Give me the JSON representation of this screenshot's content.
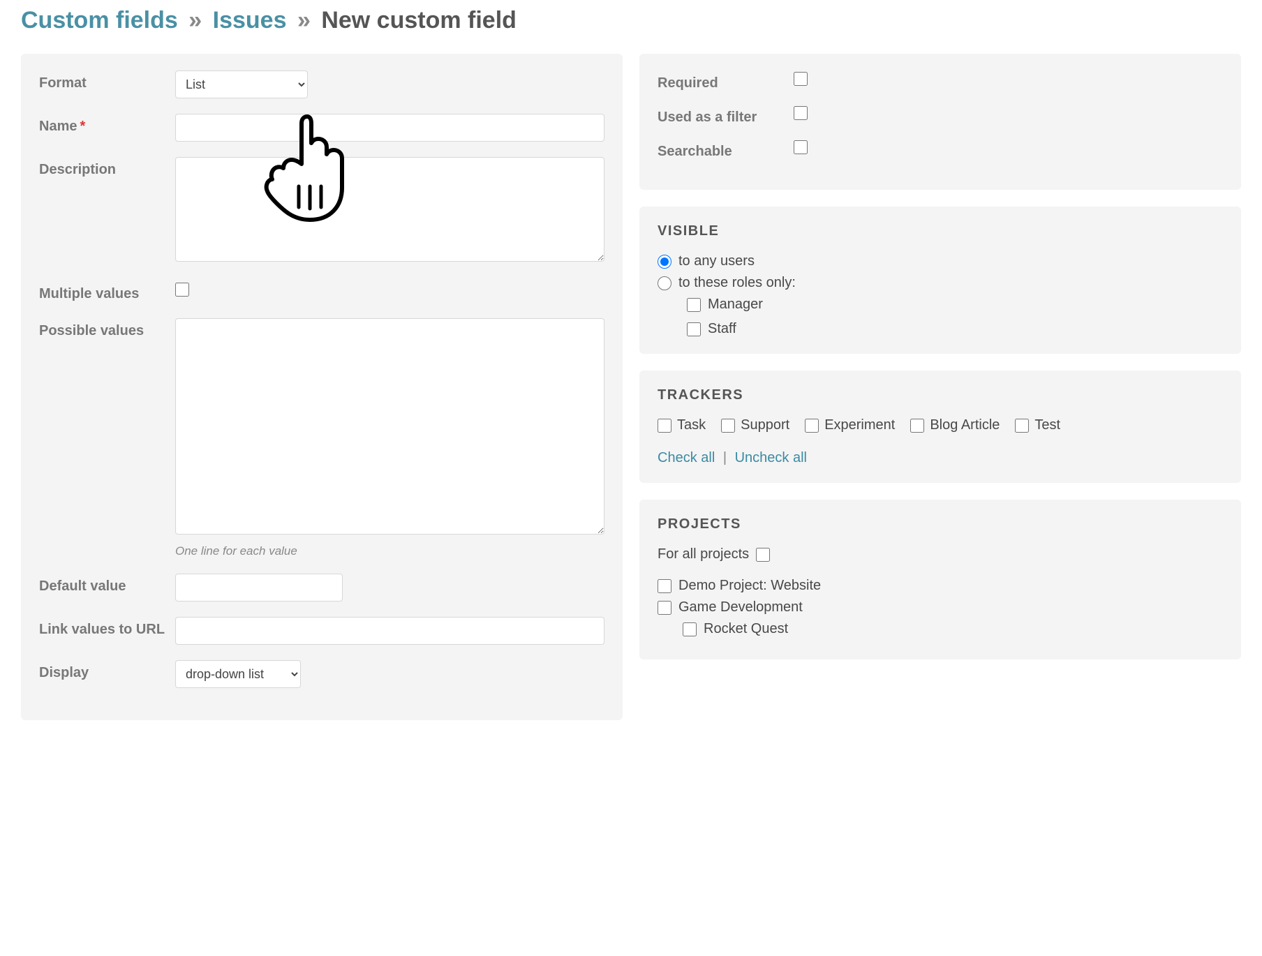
{
  "breadcrumb": {
    "custom_fields": "Custom fields",
    "issues": "Issues",
    "current": "New custom field"
  },
  "left": {
    "format_label": "Format",
    "format_value": "List",
    "name_label": "Name",
    "name_value": "",
    "description_label": "Description",
    "description_value": "",
    "multiple_label": "Multiple values",
    "multiple_checked": false,
    "possible_label": "Possible values",
    "possible_value": "",
    "possible_hint": "One line for each value",
    "default_label": "Default value",
    "default_value": "",
    "link_label": "Link values to URL",
    "link_value": "",
    "display_label": "Display",
    "display_value": "drop-down list"
  },
  "flags": {
    "required_label": "Required",
    "required": false,
    "filter_label": "Used as a filter",
    "filter": false,
    "searchable_label": "Searchable",
    "searchable": false
  },
  "visible": {
    "heading": "VISIBLE",
    "any_label": "to any users",
    "roles_label": "to these roles only:",
    "selected": "any",
    "roles": [
      {
        "label": "Manager",
        "checked": false
      },
      {
        "label": "Staff",
        "checked": false
      }
    ]
  },
  "trackers": {
    "heading": "TRACKERS",
    "items": [
      {
        "label": "Task",
        "checked": false
      },
      {
        "label": "Support",
        "checked": false
      },
      {
        "label": "Experiment",
        "checked": false
      },
      {
        "label": "Blog Article",
        "checked": false
      },
      {
        "label": "Test",
        "checked": false
      }
    ],
    "check_all": "Check all",
    "uncheck_all": "Uncheck all"
  },
  "projects": {
    "heading": "PROJECTS",
    "for_all_label": "For all projects",
    "for_all_checked": false,
    "tree": [
      {
        "label": "Demo Project: Website",
        "checked": false,
        "level": 0
      },
      {
        "label": "Game Development",
        "checked": false,
        "level": 0
      },
      {
        "label": "Rocket Quest",
        "checked": false,
        "level": 1
      }
    ]
  }
}
